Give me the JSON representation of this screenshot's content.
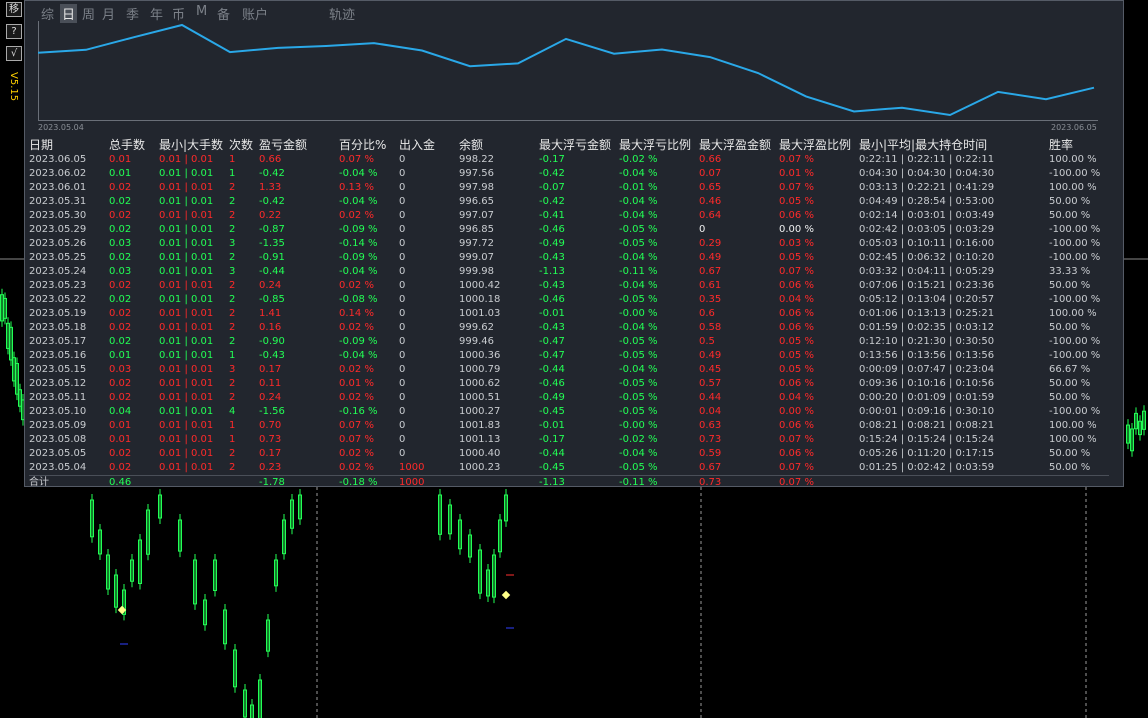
{
  "colors": {
    "up": "#22ff55",
    "down": "#ff2a2a",
    "equity_line": "#2aa8e8",
    "panel_bg": "#22262e"
  },
  "side_buttons": [
    "移",
    "?",
    "√"
  ],
  "version": "V5.15",
  "tabs": [
    {
      "label": "综",
      "active": false
    },
    {
      "label": "日",
      "active": true
    },
    {
      "label": "周",
      "active": false
    },
    {
      "label": "月",
      "active": false
    },
    {
      "label": "季",
      "active": false
    },
    {
      "label": "年",
      "active": false
    },
    {
      "label": "币",
      "active": false
    },
    {
      "label": "M",
      "active": false
    },
    {
      "label": "备",
      "active": false
    },
    {
      "label": "账户",
      "active": false
    },
    {
      "label": "轨迹",
      "active": false
    }
  ],
  "equity": {
    "start_date": "2023.05.04",
    "end_date": "2023.06.05"
  },
  "columns": [
    "日期",
    "总手数",
    "最小|大手数",
    "次数",
    "盈亏金额",
    "百分比%",
    "出入金",
    "余额",
    "最大浮亏金额",
    "最大浮亏比例",
    "最大浮盈金额",
    "最大浮盈比例",
    "最小|平均|最大持仓时间",
    "胜率"
  ],
  "rows": [
    {
      "date": "2023.06.05",
      "lots": "0.01",
      "minmax": "0.01 | 0.01",
      "count": "1",
      "pnl": "0.66",
      "pct": "0.07 %",
      "flow": "0",
      "bal": "998.22",
      "mfl": "-0.17",
      "mflp": "-0.02 %",
      "mfp": "0.66",
      "mfpp": "0.07 %",
      "hold": "0:22:11 | 0:22:11 | 0:22:11",
      "win": "100.00 %"
    },
    {
      "date": "2023.06.02",
      "lots": "0.01",
      "minmax": "0.01 | 0.01",
      "count": "1",
      "pnl": "-0.42",
      "pct": "-0.04 %",
      "flow": "0",
      "bal": "997.56",
      "mfl": "-0.42",
      "mflp": "-0.04 %",
      "mfp": "0.07",
      "mfpp": "0.01 %",
      "hold": "0:04:30 | 0:04:30 | 0:04:30",
      "win": "-100.00 %"
    },
    {
      "date": "2023.06.01",
      "lots": "0.02",
      "minmax": "0.01 | 0.01",
      "count": "2",
      "pnl": "1.33",
      "pct": "0.13 %",
      "flow": "0",
      "bal": "997.98",
      "mfl": "-0.07",
      "mflp": "-0.01 %",
      "mfp": "0.65",
      "mfpp": "0.07 %",
      "hold": "0:03:13 | 0:22:21 | 0:41:29",
      "win": "100.00 %"
    },
    {
      "date": "2023.05.31",
      "lots": "0.02",
      "minmax": "0.01 | 0.01",
      "count": "2",
      "pnl": "-0.42",
      "pct": "-0.04 %",
      "flow": "0",
      "bal": "996.65",
      "mfl": "-0.42",
      "mflp": "-0.04 %",
      "mfp": "0.46",
      "mfpp": "0.05 %",
      "hold": "0:04:49 | 0:28:54 | 0:53:00",
      "win": "50.00 %"
    },
    {
      "date": "2023.05.30",
      "lots": "0.02",
      "minmax": "0.01 | 0.01",
      "count": "2",
      "pnl": "0.22",
      "pct": "0.02 %",
      "flow": "0",
      "bal": "997.07",
      "mfl": "-0.41",
      "mflp": "-0.04 %",
      "mfp": "0.64",
      "mfpp": "0.06 %",
      "hold": "0:02:14 | 0:03:01 | 0:03:49",
      "win": "50.00 %"
    },
    {
      "date": "2023.05.29",
      "lots": "0.02",
      "minmax": "0.01 | 0.01",
      "count": "2",
      "pnl": "-0.87",
      "pct": "-0.09 %",
      "flow": "0",
      "bal": "996.85",
      "mfl": "-0.46",
      "mflp": "-0.05 %",
      "mfp": "0",
      "mfpp": "0.00 %",
      "hold": "0:02:42 | 0:03:05 | 0:03:29",
      "win": "-100.00 %"
    },
    {
      "date": "2023.05.26",
      "lots": "0.03",
      "minmax": "0.01 | 0.01",
      "count": "3",
      "pnl": "-1.35",
      "pct": "-0.14 %",
      "flow": "0",
      "bal": "997.72",
      "mfl": "-0.49",
      "mflp": "-0.05 %",
      "mfp": "0.29",
      "mfpp": "0.03 %",
      "hold": "0:05:03 | 0:10:11 | 0:16:00",
      "win": "-100.00 %"
    },
    {
      "date": "2023.05.25",
      "lots": "0.02",
      "minmax": "0.01 | 0.01",
      "count": "2",
      "pnl": "-0.91",
      "pct": "-0.09 %",
      "flow": "0",
      "bal": "999.07",
      "mfl": "-0.43",
      "mflp": "-0.04 %",
      "mfp": "0.49",
      "mfpp": "0.05 %",
      "hold": "0:02:45 | 0:06:32 | 0:10:20",
      "win": "-100.00 %"
    },
    {
      "date": "2023.05.24",
      "lots": "0.03",
      "minmax": "0.01 | 0.01",
      "count": "3",
      "pnl": "-0.44",
      "pct": "-0.04 %",
      "flow": "0",
      "bal": "999.98",
      "mfl": "-1.13",
      "mflp": "-0.11 %",
      "mfp": "0.67",
      "mfpp": "0.07 %",
      "hold": "0:03:32 | 0:04:11 | 0:05:29",
      "win": "33.33 %"
    },
    {
      "date": "2023.05.23",
      "lots": "0.02",
      "minmax": "0.01 | 0.01",
      "count": "2",
      "pnl": "0.24",
      "pct": "0.02 %",
      "flow": "0",
      "bal": "1000.42",
      "mfl": "-0.43",
      "mflp": "-0.04 %",
      "mfp": "0.61",
      "mfpp": "0.06 %",
      "hold": "0:07:06 | 0:15:21 | 0:23:36",
      "win": "50.00 %"
    },
    {
      "date": "2023.05.22",
      "lots": "0.02",
      "minmax": "0.01 | 0.01",
      "count": "2",
      "pnl": "-0.85",
      "pct": "-0.08 %",
      "flow": "0",
      "bal": "1000.18",
      "mfl": "-0.46",
      "mflp": "-0.05 %",
      "mfp": "0.35",
      "mfpp": "0.04 %",
      "hold": "0:05:12 | 0:13:04 | 0:20:57",
      "win": "-100.00 %"
    },
    {
      "date": "2023.05.19",
      "lots": "0.02",
      "minmax": "0.01 | 0.01",
      "count": "2",
      "pnl": "1.41",
      "pct": "0.14 %",
      "flow": "0",
      "bal": "1001.03",
      "mfl": "-0.01",
      "mflp": "-0.00 %",
      "mfp": "0.6",
      "mfpp": "0.06 %",
      "hold": "0:01:06 | 0:13:13 | 0:25:21",
      "win": "100.00 %"
    },
    {
      "date": "2023.05.18",
      "lots": "0.02",
      "minmax": "0.01 | 0.01",
      "count": "2",
      "pnl": "0.16",
      "pct": "0.02 %",
      "flow": "0",
      "bal": "999.62",
      "mfl": "-0.43",
      "mflp": "-0.04 %",
      "mfp": "0.58",
      "mfpp": "0.06 %",
      "hold": "0:01:59 | 0:02:35 | 0:03:12",
      "win": "50.00 %"
    },
    {
      "date": "2023.05.17",
      "lots": "0.02",
      "minmax": "0.01 | 0.01",
      "count": "2",
      "pnl": "-0.90",
      "pct": "-0.09 %",
      "flow": "0",
      "bal": "999.46",
      "mfl": "-0.47",
      "mflp": "-0.05 %",
      "mfp": "0.5",
      "mfpp": "0.05 %",
      "hold": "0:12:10 | 0:21:30 | 0:30:50",
      "win": "-100.00 %"
    },
    {
      "date": "2023.05.16",
      "lots": "0.01",
      "minmax": "0.01 | 0.01",
      "count": "1",
      "pnl": "-0.43",
      "pct": "-0.04 %",
      "flow": "0",
      "bal": "1000.36",
      "mfl": "-0.47",
      "mflp": "-0.05 %",
      "mfp": "0.49",
      "mfpp": "0.05 %",
      "hold": "0:13:56 | 0:13:56 | 0:13:56",
      "win": "-100.00 %"
    },
    {
      "date": "2023.05.15",
      "lots": "0.03",
      "minmax": "0.01 | 0.01",
      "count": "3",
      "pnl": "0.17",
      "pct": "0.02 %",
      "flow": "0",
      "bal": "1000.79",
      "mfl": "-0.44",
      "mflp": "-0.04 %",
      "mfp": "0.45",
      "mfpp": "0.05 %",
      "hold": "0:00:09 | 0:07:47 | 0:23:04",
      "win": "66.67 %"
    },
    {
      "date": "2023.05.12",
      "lots": "0.02",
      "minmax": "0.01 | 0.01",
      "count": "2",
      "pnl": "0.11",
      "pct": "0.01 %",
      "flow": "0",
      "bal": "1000.62",
      "mfl": "-0.46",
      "mflp": "-0.05 %",
      "mfp": "0.57",
      "mfpp": "0.06 %",
      "hold": "0:09:36 | 0:10:16 | 0:10:56",
      "win": "50.00 %"
    },
    {
      "date": "2023.05.11",
      "lots": "0.02",
      "minmax": "0.01 | 0.01",
      "count": "2",
      "pnl": "0.24",
      "pct": "0.02 %",
      "flow": "0",
      "bal": "1000.51",
      "mfl": "-0.49",
      "mflp": "-0.05 %",
      "mfp": "0.44",
      "mfpp": "0.04 %",
      "hold": "0:00:20 | 0:01:09 | 0:01:59",
      "win": "50.00 %"
    },
    {
      "date": "2023.05.10",
      "lots": "0.04",
      "minmax": "0.01 | 0.01",
      "count": "4",
      "pnl": "-1.56",
      "pct": "-0.16 %",
      "flow": "0",
      "bal": "1000.27",
      "mfl": "-0.45",
      "mflp": "-0.05 %",
      "mfp": "0.04",
      "mfpp": "0.00 %",
      "hold": "0:00:01 | 0:09:16 | 0:30:10",
      "win": "-100.00 %"
    },
    {
      "date": "2023.05.09",
      "lots": "0.01",
      "minmax": "0.01 | 0.01",
      "count": "1",
      "pnl": "0.70",
      "pct": "0.07 %",
      "flow": "0",
      "bal": "1001.83",
      "mfl": "-0.01",
      "mflp": "-0.00 %",
      "mfp": "0.63",
      "mfpp": "0.06 %",
      "hold": "0:08:21 | 0:08:21 | 0:08:21",
      "win": "100.00 %"
    },
    {
      "date": "2023.05.08",
      "lots": "0.01",
      "minmax": "0.01 | 0.01",
      "count": "1",
      "pnl": "0.73",
      "pct": "0.07 %",
      "flow": "0",
      "bal": "1001.13",
      "mfl": "-0.17",
      "mflp": "-0.02 %",
      "mfp": "0.73",
      "mfpp": "0.07 %",
      "hold": "0:15:24 | 0:15:24 | 0:15:24",
      "win": "100.00 %"
    },
    {
      "date": "2023.05.05",
      "lots": "0.02",
      "minmax": "0.01 | 0.01",
      "count": "2",
      "pnl": "0.17",
      "pct": "0.02 %",
      "flow": "0",
      "bal": "1000.40",
      "mfl": "-0.44",
      "mflp": "-0.04 %",
      "mfp": "0.59",
      "mfpp": "0.06 %",
      "hold": "0:05:26 | 0:11:20 | 0:17:15",
      "win": "50.00 %"
    },
    {
      "date": "2023.05.04",
      "lots": "0.02",
      "minmax": "0.01 | 0.01",
      "count": "2",
      "pnl": "0.23",
      "pct": "0.02 %",
      "flow": "1000",
      "bal": "1000.23",
      "mfl": "-0.45",
      "mflp": "-0.05 %",
      "mfp": "0.67",
      "mfpp": "0.07 %",
      "hold": "0:01:25 | 0:02:42 | 0:03:59",
      "win": "50.00 %"
    }
  ],
  "total": {
    "label": "合计",
    "lots": "0.46",
    "pnl": "-1.78",
    "pct": "-0.18 %",
    "flow": "1000",
    "mfl": "-1.13",
    "mflp": "-0.11 %",
    "mfp": "0.73",
    "mfpp": "0.07 %"
  }
}
